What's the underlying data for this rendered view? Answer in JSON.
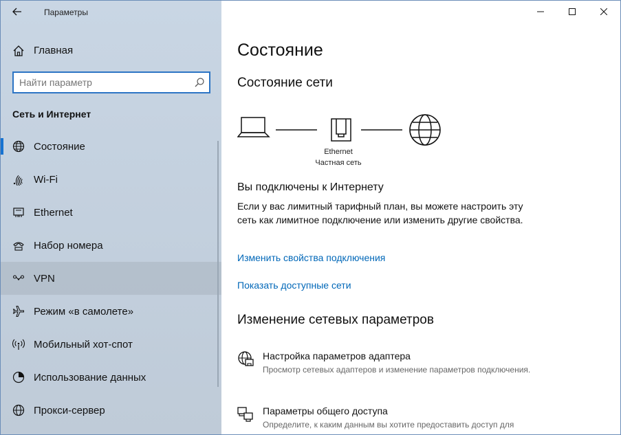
{
  "window": {
    "app_title": "Параметры"
  },
  "sidebar": {
    "home_label": "Главная",
    "search_placeholder": "Найти параметр",
    "section_title": "Сеть и Интернет",
    "items": [
      {
        "label": "Состояние",
        "icon": "globe-status-icon",
        "active": true
      },
      {
        "label": "Wi-Fi",
        "icon": "wifi-icon"
      },
      {
        "label": "Ethernet",
        "icon": "ethernet-icon"
      },
      {
        "label": "Набор номера",
        "icon": "dialup-icon"
      },
      {
        "label": "VPN",
        "icon": "vpn-icon",
        "hover": true
      },
      {
        "label": "Режим «в самолете»",
        "icon": "airplane-icon"
      },
      {
        "label": "Мобильный хот-спот",
        "icon": "hotspot-icon"
      },
      {
        "label": "Использование данных",
        "icon": "data-usage-icon"
      },
      {
        "label": "Прокси-сервер",
        "icon": "globe-icon"
      }
    ]
  },
  "main": {
    "title": "Состояние",
    "network_status_title": "Состояние сети",
    "diagram": {
      "adapter_name": "Ethernet",
      "network_type": "Частная сеть"
    },
    "connected_title": "Вы подключены к Интернету",
    "connected_desc": "Если у вас лимитный тарифный план, вы можете настроить эту сеть как лимитное подключение или изменить другие свойства.",
    "link_change_props": "Изменить свойства подключения",
    "link_show_networks": "Показать доступные сети",
    "change_section_title": "Изменение сетевых параметров",
    "options": [
      {
        "title": "Настройка параметров адаптера",
        "desc": "Просмотр сетевых адаптеров и изменение параметров подключения.",
        "icon": "adapter-icon"
      },
      {
        "title": "Параметры общего доступа",
        "desc": "Определите, к каким данным вы хотите предоставить доступ для",
        "icon": "sharing-icon"
      }
    ]
  },
  "colors": {
    "accent": "#1773d1",
    "link": "#0067b8",
    "sidebar_bg": "#c6d3e1"
  }
}
